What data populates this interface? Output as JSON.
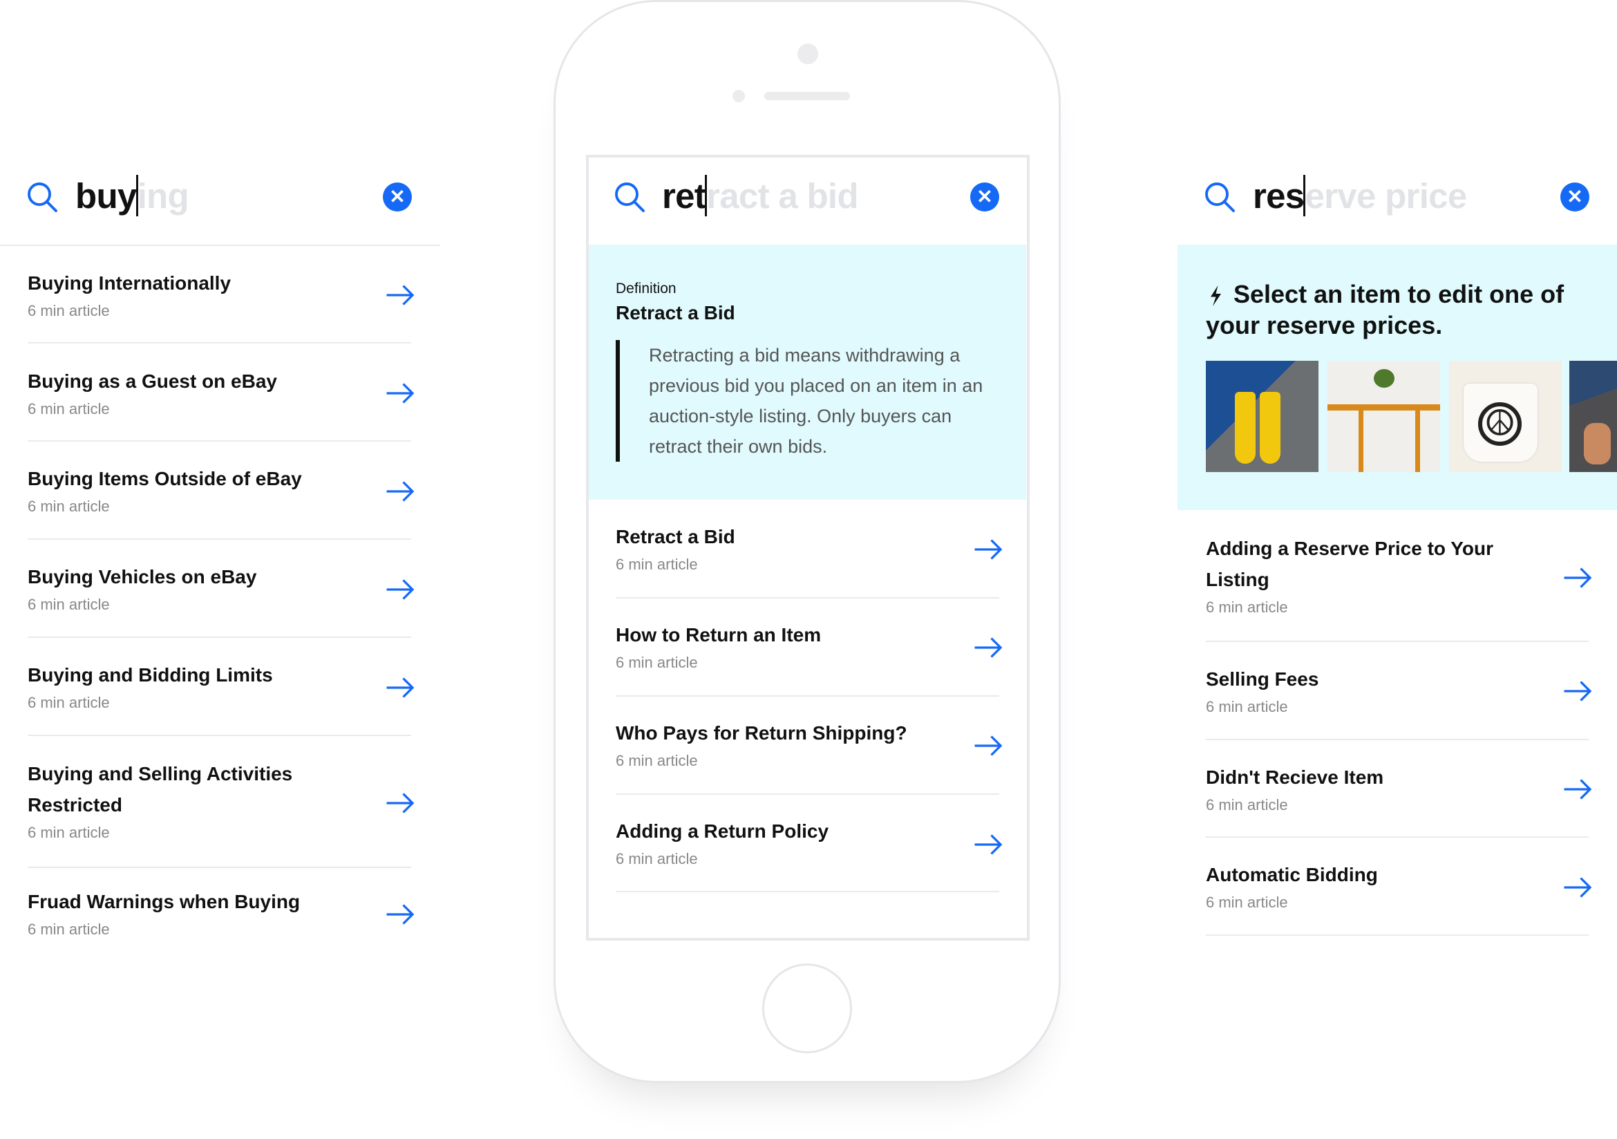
{
  "colors": {
    "accent": "#1569f5",
    "highlight_bg": "#e0fafd",
    "ghost_text": "#e1e3e6"
  },
  "left": {
    "search": {
      "typed": "buy",
      "suggestion": "ing",
      "icon": "search-icon",
      "clear_icon": "close-icon"
    },
    "results": [
      {
        "title": "Buying Internationally",
        "meta": "6 min article"
      },
      {
        "title": "Buying as a Guest on eBay",
        "meta": "6 min article"
      },
      {
        "title": "Buying Items Outside of eBay",
        "meta": "6 min article"
      },
      {
        "title": "Buying Vehicles on eBay",
        "meta": "6 min article"
      },
      {
        "title": "Buying and Bidding Limits",
        "meta": "6 min article"
      },
      {
        "title": "Buying and Selling Activities Restricted",
        "meta": "6 min article"
      },
      {
        "title": "Fruad Warnings when Buying",
        "meta": "6 min article"
      }
    ]
  },
  "phone": {
    "search": {
      "typed": "ret",
      "suggestion": "ract a bid",
      "icon": "search-icon",
      "clear_icon": "close-icon"
    },
    "definition": {
      "label": "Definition",
      "term": "Retract a Bid",
      "text": "Retracting a bid means withdrawing a previous bid you placed on an item in an auction-style listing. Only buyers can retract their own bids."
    },
    "results": [
      {
        "title": "Retract a Bid",
        "meta": "6 min article"
      },
      {
        "title": "How to Return an Item",
        "meta": "6 min article"
      },
      {
        "title": "Who Pays for Return Shipping?",
        "meta": "6 min article"
      },
      {
        "title": "Adding a Return Policy",
        "meta": "6 min article"
      }
    ]
  },
  "right": {
    "search": {
      "typed": "res",
      "suggestion": "erve price",
      "icon": "search-icon",
      "clear_icon": "close-icon"
    },
    "prompt": {
      "icon": "lightning-bolt-icon",
      "text": "Select an item to edit one of your reserve prices."
    },
    "items": [
      "yellow-rain-boots",
      "wooden-magazine-table",
      "peace-sign-mug",
      "sandals"
    ],
    "results": [
      {
        "title": "Adding a Reserve Price to Your Listing",
        "meta": "6 min article"
      },
      {
        "title": "Selling Fees",
        "meta": "6 min article"
      },
      {
        "title": "Didn't Recieve Item",
        "meta": "6 min article"
      },
      {
        "title": "Automatic Bidding",
        "meta": "6 min article"
      }
    ]
  }
}
